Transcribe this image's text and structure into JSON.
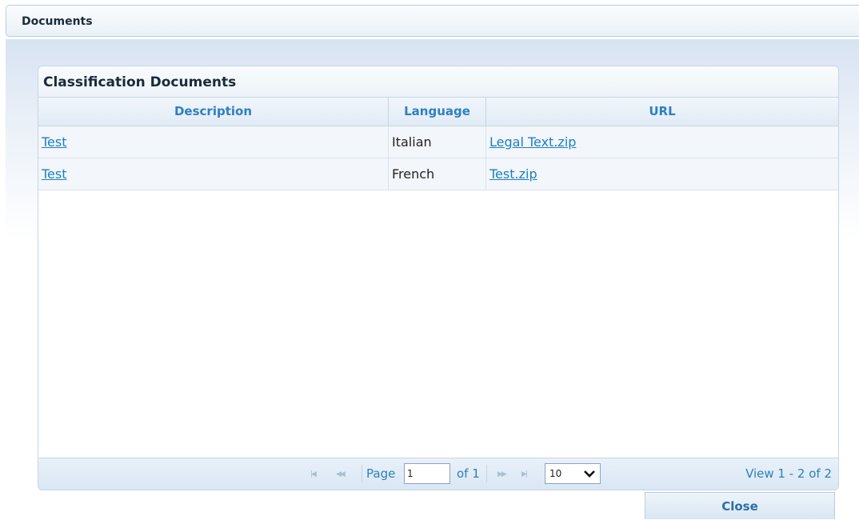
{
  "window": {
    "title": "Documents"
  },
  "panel": {
    "title": "Classification Documents"
  },
  "table": {
    "columns": [
      "Description",
      "Language",
      "URL"
    ],
    "rows": [
      {
        "description": "Test",
        "language": "Italian",
        "url": "Legal Text.zip"
      },
      {
        "description": "Test",
        "language": "French",
        "url": "Test.zip"
      }
    ]
  },
  "pager": {
    "page_label": "Page",
    "page_value": "1",
    "of_label": "of 1",
    "rows_per_page": "10",
    "view_text": "View 1 - 2 of 2"
  },
  "footer": {
    "close_label": "Close"
  },
  "colors": {
    "link": "#1e7fc4",
    "header_text": "#2e7fc0",
    "border": "#c5d6e6"
  }
}
